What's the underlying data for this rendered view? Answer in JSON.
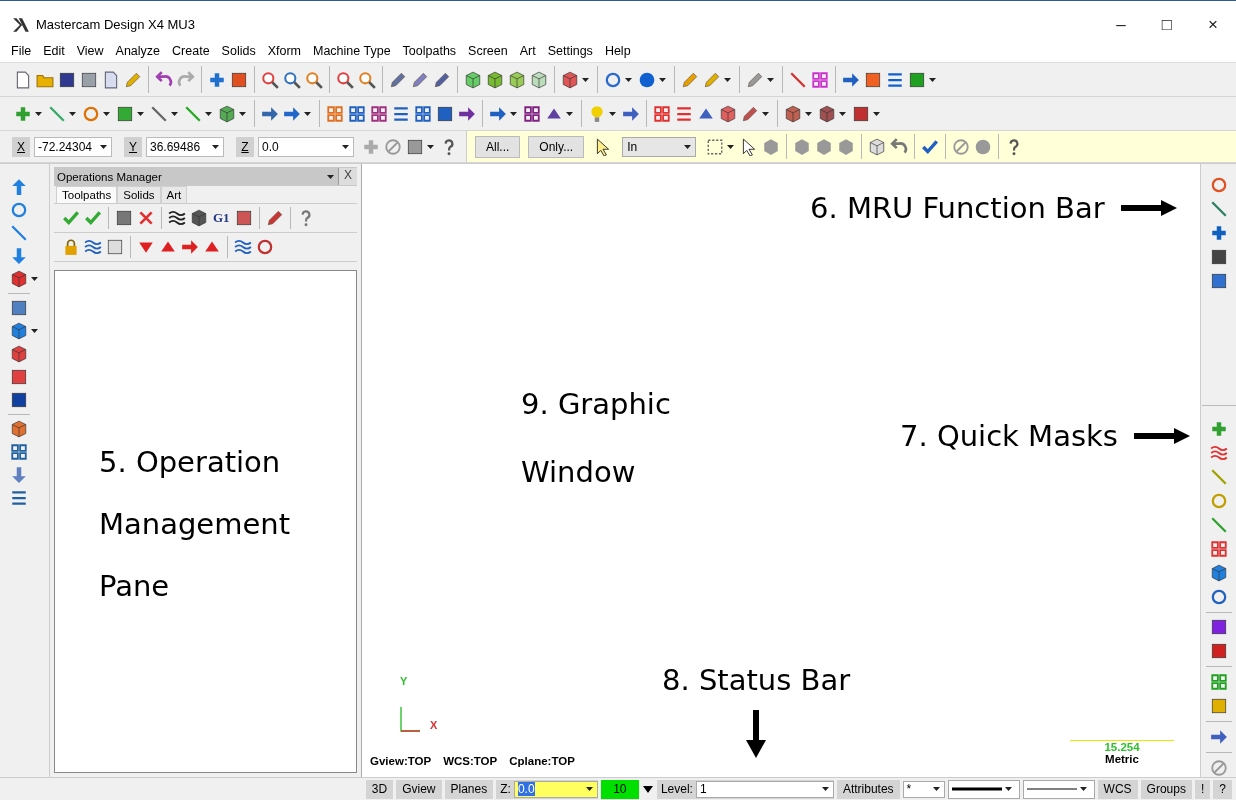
{
  "window": {
    "title": "Mastercam Design X4 MU3",
    "controls": [
      "–",
      "□",
      "×"
    ]
  },
  "menu": [
    "File",
    "Edit",
    "View",
    "Analyze",
    "Create",
    "Solids",
    "Xform",
    "Machine Type",
    "Toolpaths",
    "Screen",
    "Art",
    "Settings",
    "Help"
  ],
  "coordinates": [
    {
      "label": "X",
      "value": "-72.24304"
    },
    {
      "label": "Y",
      "value": "36.69486"
    },
    {
      "label": "Z",
      "value": "0.0"
    }
  ],
  "selection_bar": {
    "buttons": [
      "All...",
      "Only..."
    ],
    "mode": "In"
  },
  "operations_manager": {
    "title": "Operations Manager",
    "close": "X",
    "g1_button": "G1",
    "tabs": [
      {
        "label": "Toolpaths",
        "selected": true
      },
      {
        "label": "Solids",
        "selected": false
      },
      {
        "label": "Art",
        "selected": false
      }
    ],
    "annotation": "5. Operation Management Pane"
  },
  "graphic_window": {
    "axis_labels": [
      "Y",
      "X"
    ],
    "view_info": [
      "Gview:TOP",
      "WCS:TOP",
      "Cplane:TOP"
    ],
    "scale": {
      "value": "15.254",
      "unit": "Metric"
    },
    "annotations": [
      {
        "text": "6. MRU Function Bar",
        "kind": "right"
      },
      {
        "text": "9. Graphic Window",
        "kind": "plain"
      },
      {
        "text": "7. Quick Masks",
        "kind": "right"
      },
      {
        "text": "8. Status Bar",
        "kind": "down"
      }
    ]
  },
  "status_bar": [
    {
      "kind": "button",
      "text": "3D"
    },
    {
      "kind": "button",
      "text": "Gview"
    },
    {
      "kind": "button",
      "text": "Planes"
    },
    {
      "kind": "field",
      "label": "Z:",
      "value": "0.0"
    },
    {
      "kind": "color",
      "value": "10",
      "color": "#00e000"
    },
    {
      "kind": "field",
      "label": "Level:",
      "value": "1"
    },
    {
      "kind": "button",
      "text": "Attributes"
    },
    {
      "kind": "combo",
      "value": "*"
    },
    {
      "kind": "heavyline"
    },
    {
      "kind": "lightline"
    },
    {
      "kind": "button",
      "text": "WCS"
    },
    {
      "kind": "button",
      "text": "Groups"
    },
    {
      "kind": "button",
      "text": "!"
    },
    {
      "kind": "button",
      "text": "?"
    }
  ]
}
